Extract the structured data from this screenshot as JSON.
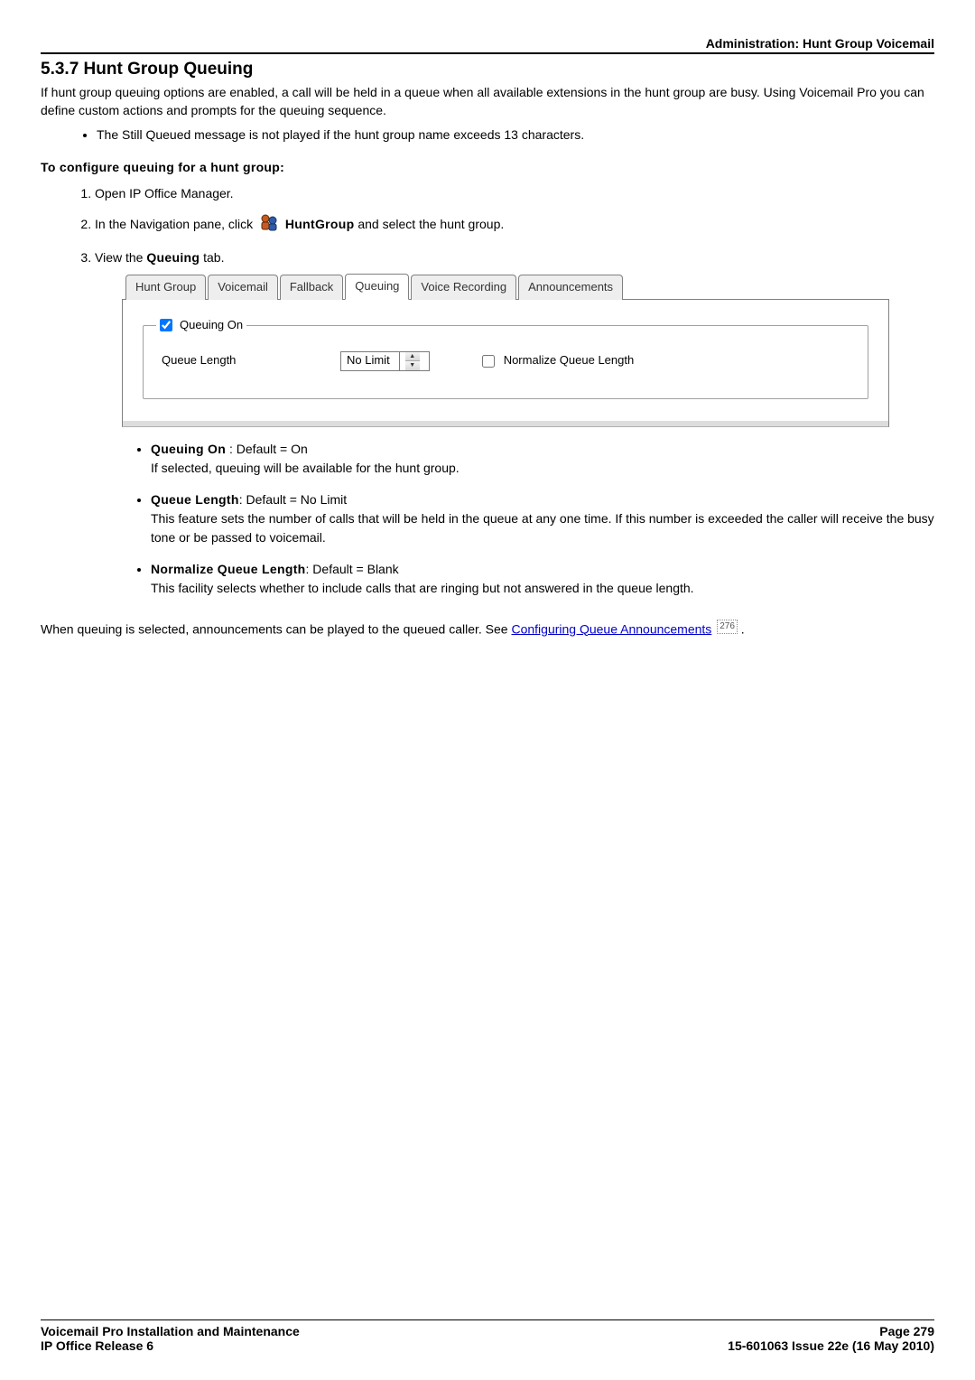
{
  "header": {
    "title": "Administration: Hunt Group Voicemail"
  },
  "section": {
    "number": "5.3.7 Hunt Group Queuing",
    "intro": "If hunt group queuing options are enabled, a call will be held in a queue when all available extensions in the hunt group are busy. Using Voicemail Pro you can define custom actions and prompts for the queuing sequence.",
    "note1": "The Still Queued message is not played if the hunt group name exceeds 13 characters.",
    "configure_heading": "To configure queuing for a hunt group:",
    "step1": "Open IP Office Manager.",
    "step2_pre": "In the Navigation pane, click ",
    "step2_term": "HuntGroup",
    "step2_post": " and select the hunt group.",
    "step3_pre": "View the ",
    "step3_tab": "Queuing",
    "step3_post": " tab."
  },
  "tabs": {
    "t0": "Hunt Group",
    "t1": "Voicemail",
    "t2": "Fallback",
    "t3": "Queuing",
    "t4": "Voice Recording",
    "t5": "Announcements"
  },
  "form": {
    "queuing_on_label": "Queuing On",
    "queue_length_label": "Queue Length",
    "queue_length_value": "No Limit",
    "normalize_label": "Normalize Queue Length"
  },
  "bullets": {
    "b1_term": "Queuing On",
    "b1_colon": " : Default = On",
    "b1_text": "If selected, queuing will be available for the hunt group.",
    "b2_term": "Queue Length",
    "b2_colon": ": Default = No Limit",
    "b2_text": "This feature sets the number of calls that will be held in the queue at any one time. If this number is exceeded the caller will receive the busy tone or be passed to voicemail.",
    "b3_term": "Normalize Queue Length",
    "b3_colon": ": Default = Blank",
    "b3_text": "This facility selects whether to include calls that are ringing but not answered in the queue length."
  },
  "closing": {
    "text_pre": "When queuing is selected, announcements can be played to the queued caller. See ",
    "link": "Configuring Queue Announcements",
    "ref": "276"
  },
  "footer": {
    "left1": "Voicemail Pro Installation and Maintenance",
    "left2": "IP Office Release 6",
    "right1": "Page 279",
    "right2": "15-601063 Issue 22e (16 May 2010)"
  }
}
